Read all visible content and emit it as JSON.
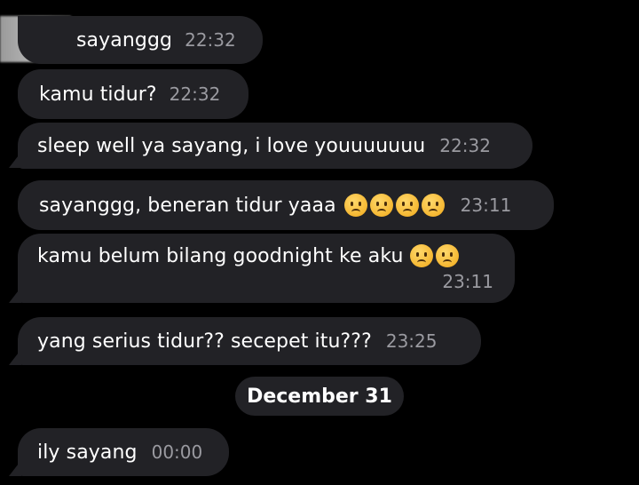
{
  "messages": [
    {
      "text": "sayanggg",
      "time": "22:32"
    },
    {
      "text": "kamu tidur?",
      "time": "22:32"
    },
    {
      "text": "sleep well ya sayang, i love youuuuuuu",
      "time": "22:32"
    },
    {
      "text": "sayanggg, beneran tidur yaaa",
      "time": "23:11",
      "emojis": [
        "sad-face",
        "sad-face",
        "sad-face",
        "sad-face"
      ]
    },
    {
      "text": "kamu belum bilang goodnight ke aku",
      "time": "23:11",
      "emojis": [
        "sad-face",
        "sad-face"
      ]
    },
    {
      "text": "yang serius tidur?? secepet itu???",
      "time": "23:25"
    },
    {
      "text": "ily sayang",
      "time": "00:00"
    }
  ],
  "date_separator": "December 31",
  "colors": {
    "background": "#000000",
    "bubble": "#222226",
    "timestamp": "#9a9aa0"
  }
}
